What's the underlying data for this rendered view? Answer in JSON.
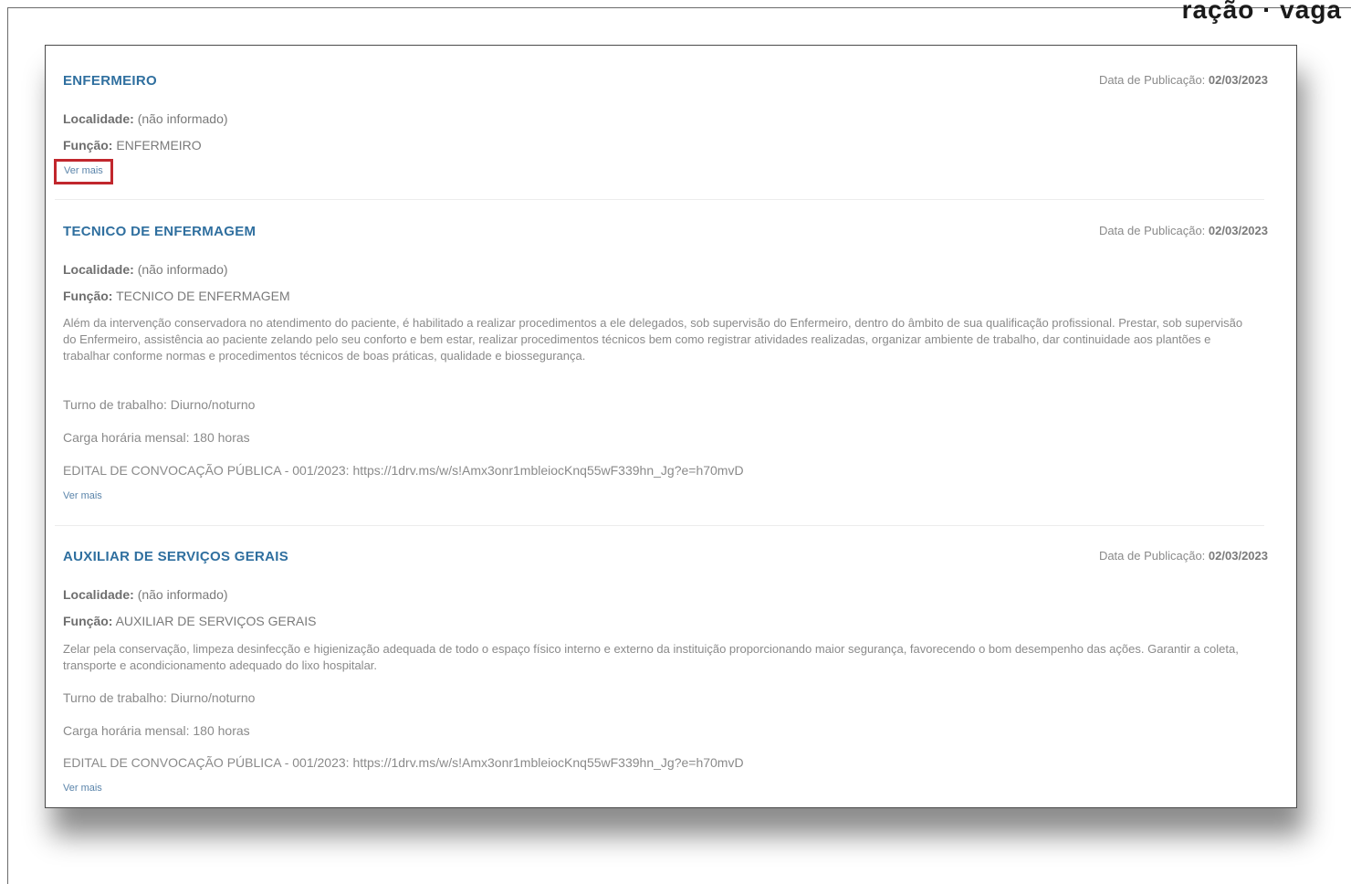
{
  "header_fragment": "ração · vaga",
  "jobs": [
    {
      "title": "ENFERMEIRO",
      "pub_label": "Data de Publicação:",
      "pub_date": "02/03/2023",
      "localidade_label": "Localidade:",
      "localidade_value": "(não informado)",
      "funcao_label": "Função:",
      "funcao_value": "ENFERMEIRO",
      "ver_mais": "Ver mais"
    },
    {
      "title": "TECNICO DE ENFERMAGEM",
      "pub_label": "Data de Publicação:",
      "pub_date": "02/03/2023",
      "localidade_label": "Localidade:",
      "localidade_value": "(não informado)",
      "funcao_label": "Função:",
      "funcao_value": "TECNICO DE ENFERMAGEM",
      "description": "Além da intervenção conservadora no atendimento do paciente, é habilitado a realizar procedimentos a ele delegados, sob supervisão do Enfermeiro, dentro do âmbito de sua qualificação profissional. Prestar, sob supervisão do Enfermeiro, assistência ao paciente zelando pelo seu conforto e bem estar, realizar procedimentos técnicos bem como registrar atividades realizadas, organizar ambiente de trabalho, dar continuidade aos plantões e trabalhar conforme normas e procedimentos técnicos de boas práticas, qualidade e biossegurança.",
      "turno": "Turno de trabalho: Diurno/noturno",
      "carga": "Carga horária mensal: 180 horas",
      "edital": "EDITAL DE CONVOCAÇÃO PÚBLICA - 001/2023: https://1drv.ms/w/s!Amx3onr1mbleiocKnq55wF339hn_Jg?e=h70mvD",
      "ver_mais": "Ver mais"
    },
    {
      "title": "AUXILIAR DE SERVIÇOS GERAIS",
      "pub_label": "Data de Publicação:",
      "pub_date": "02/03/2023",
      "localidade_label": "Localidade:",
      "localidade_value": "(não informado)",
      "funcao_label": "Função:",
      "funcao_value": "AUXILIAR DE SERVIÇOS GERAIS",
      "description": "Zelar pela conservação, limpeza desinfecção e higienização adequada de todo o espaço físico interno e externo da instituição proporcionando maior segurança, favorecendo o bom desempenho das ações. Garantir a coleta, transporte e acondicionamento adequado do lixo hospitalar.",
      "turno": "Turno de trabalho: Diurno/noturno",
      "carga": "Carga horária mensal: 180 horas",
      "edital": "EDITAL DE CONVOCAÇÃO PÚBLICA - 001/2023: https://1drv.ms/w/s!Amx3onr1mbleiocKnq55wF339hn_Jg?e=h70mvD",
      "ver_mais": "Ver mais"
    }
  ]
}
